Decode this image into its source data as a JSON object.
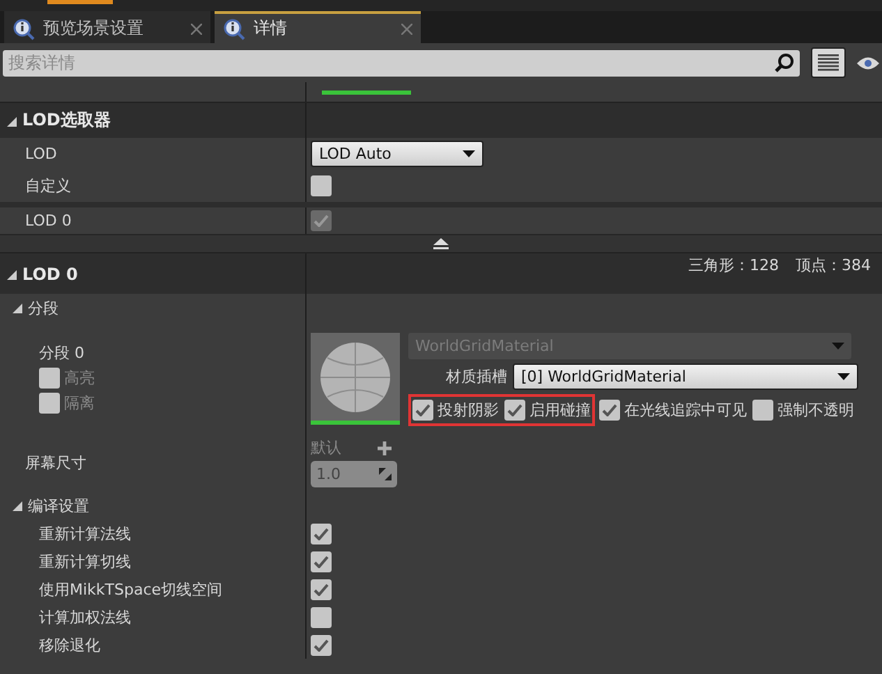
{
  "tabs": [
    {
      "label": "预览场景设置",
      "selected": false
    },
    {
      "label": "详情",
      "selected": true
    }
  ],
  "search": {
    "placeholder": "搜索详情"
  },
  "lod_picker": {
    "title": "LOD选取器",
    "expanded": true,
    "rows": [
      {
        "kind": "dropdown",
        "label": "LOD",
        "value": "LOD Auto"
      },
      {
        "kind": "checkbox",
        "label": "自定义",
        "checked": false,
        "disabled": false
      },
      {
        "kind": "checkbox",
        "label": "LOD 0",
        "checked": true,
        "disabled": true
      }
    ]
  },
  "stats": {
    "triangles_label": "三角形：128",
    "vertices_label": "顶点：384"
  },
  "lod0": {
    "title": "LOD 0",
    "expanded": true,
    "sections": {
      "title": "分段",
      "expanded": true,
      "section_label": "分段 0",
      "section_options": [
        {
          "label": "高亮",
          "checked": false
        },
        {
          "label": "隔离",
          "checked": false
        }
      ],
      "material_name": "WorldGridMaterial",
      "slot_label": "材质插槽",
      "slot_value": "[0] WorldGridMaterial",
      "material_option_groups": [
        {
          "highlighted": true,
          "options": [
            {
              "label": "投射阴影",
              "checked": true
            },
            {
              "label": "启用碰撞",
              "checked": true
            }
          ]
        },
        {
          "highlighted": false,
          "options": [
            {
              "label": "在光线追踪中可见",
              "checked": true
            },
            {
              "label": "强制不透明",
              "checked": false
            }
          ]
        }
      ]
    },
    "screen_size": {
      "label": "屏幕尺寸",
      "default_label": "默认",
      "value": "1.0"
    },
    "build_settings": {
      "title": "编译设置",
      "expanded": true,
      "rows": [
        {
          "label": "重新计算法线",
          "checked": true
        },
        {
          "label": "重新计算切线",
          "checked": true
        },
        {
          "label": "使用MikkTSpace切线空间",
          "checked": true
        },
        {
          "label": "计算加权法线",
          "checked": false
        },
        {
          "label": "移除退化",
          "checked": true
        }
      ]
    }
  }
}
